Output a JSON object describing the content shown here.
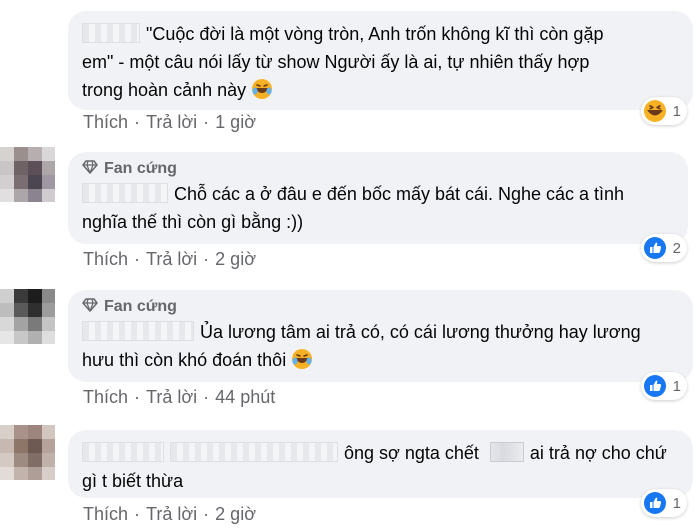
{
  "comments": [
    {
      "badge": "",
      "text": "\"Cuộc đời là một vòng tròn, Anh trốn không kĩ thì còn gặp em\" - một câu nói lấy từ show Người ấy là ai, tự nhiên thấy hợp trong hoàn cảnh này",
      "line1": "\"Cuộc đời là một vòng tròn, Anh trốn không kĩ thì còn gặp",
      "line2": "em\" - một câu nói lấy từ show Người ấy là ai, tự nhiên thấy hợp",
      "line3": "trong hoàn cảnh này",
      "like_label": "Thích",
      "reply_label": "Trả lời",
      "time": "1 giờ",
      "reaction_icon": "haha-icon",
      "reaction_count": "1"
    },
    {
      "badge": "Fan cứng",
      "line1": "Chỗ các a ở đâu e đến bốc mấy bát cái. Nghe các a tình",
      "line2": "nghĩa thế thì còn gì bằng :))",
      "like_label": "Thích",
      "reply_label": "Trả lời",
      "time": "2 giờ",
      "reaction_icon": "like-icon",
      "reaction_count": "2"
    },
    {
      "badge": "Fan cứng",
      "line1": "Ủa lương tâm ai trả có, có cái lương thưởng hay lương",
      "line2": "hưu thì còn khó đoán thôi",
      "like_label": "Thích",
      "reply_label": "Trả lời",
      "time": "44 phút",
      "reaction_icon": "like-icon",
      "reaction_count": "1"
    },
    {
      "badge": "",
      "line1a": "ông sợ ngta chết",
      "line1b": "ai trả nợ cho chứ",
      "line2": "gì t biết thừa",
      "like_label": "Thích",
      "reply_label": "Trả lời",
      "time": "2 giờ",
      "reaction_icon": "like-icon",
      "reaction_count": "1"
    }
  ],
  "colors": {
    "bubble": "#f0f2f5",
    "meta_text": "#65676b",
    "like_blue": "#1877f2",
    "haha_yellow": "#f7b125"
  }
}
